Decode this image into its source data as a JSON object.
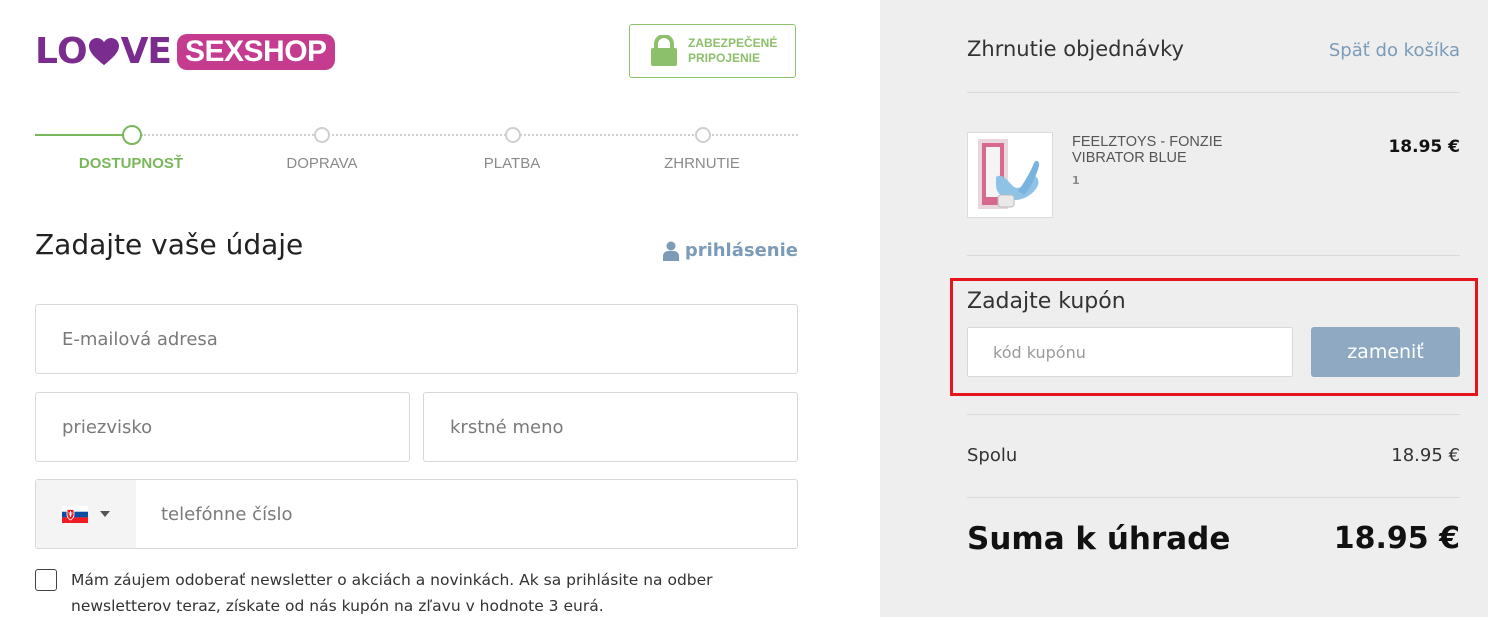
{
  "brand": {
    "logo_love": "L",
    "logo_love_end": "VE",
    "logo_shop": "SEXSHOP",
    "colors": {
      "purple": "#7b2c8f",
      "pink": "#c43b8f",
      "green": "#78b75a",
      "link": "#7b9bb8"
    }
  },
  "secure_badge": {
    "line1": "ZABEZPEČENÉ",
    "line2": "PRIPOJENIE",
    "icon": "lock-icon"
  },
  "steps": [
    {
      "label": "DOSTUPNOSŤ",
      "active": true
    },
    {
      "label": "DOPRAVA",
      "active": false
    },
    {
      "label": "PLATBA",
      "active": false
    },
    {
      "label": "ZHRNUTIE",
      "active": false
    }
  ],
  "form": {
    "title": "Zadajte vaše údaje",
    "login_link": "prihlásenie",
    "email_placeholder": "E-mailová adresa",
    "surname_placeholder": "priezvisko",
    "firstname_placeholder": "krstné meno",
    "phone_placeholder": "telefónne číslo",
    "phone_country": "Slovakia",
    "newsletter_text": "Mám záujem odoberať newsletter o akciách a novinkách. Ak sa prihlásite na odber newsletterov teraz, získate od nás kupón na zľavu v hodnote 3 eurá."
  },
  "summary": {
    "title": "Zhrnutie objednávky",
    "back_link": "Späť do košíka",
    "item": {
      "name": "FEELZTOYS - FONZIE VIBRATOR BLUE",
      "qty": "1",
      "price": "18.95 €"
    },
    "coupon_title": "Zadajte kupón",
    "coupon_placeholder": "kód kupónu",
    "coupon_button": "zameniť",
    "subtotal_label": "Spolu",
    "subtotal_value": "18.95 €",
    "total_label": "Suma k úhrade",
    "total_value": "18.95 €"
  }
}
